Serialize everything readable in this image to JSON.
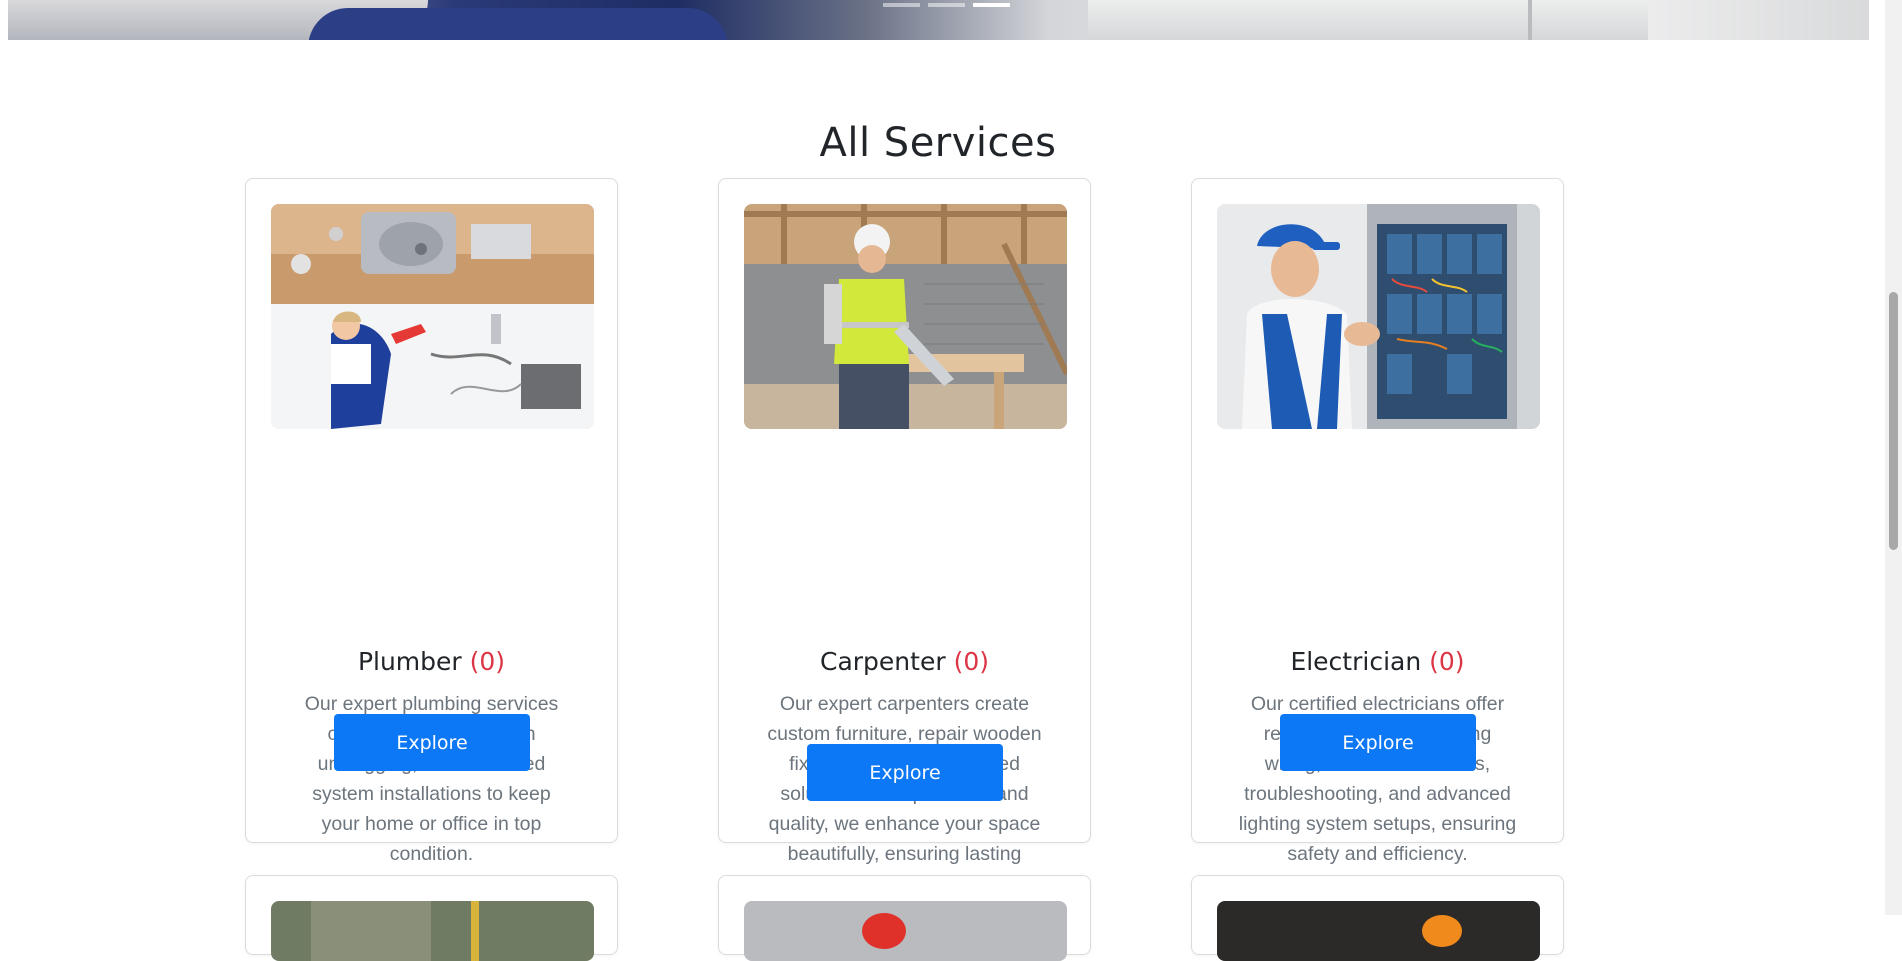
{
  "hero": {
    "slides": 3,
    "active_slide": 3
  },
  "section_title": "All Services",
  "cards": [
    {
      "name": "Plumber",
      "count": "(0)",
      "description": "Our expert plumbing services cover leak repairs, drain unclogging, and advanced system installations to keep your home or office in top condition.",
      "button": "Explore"
    },
    {
      "name": "Carpenter",
      "count": "(0)",
      "description": "Our expert carpenters create custom furniture, repair wooden fixtures, and install tailored solutions. With precision and quality, we enhance your space beautifully, ensuring lasting durability.",
      "button": "Explore"
    },
    {
      "name": "Electrician",
      "count": "(0)",
      "description": "Our certified electricians offer reliable services, including wiring, circuit installations, troubleshooting, and advanced lighting system setups, ensuring safety and efficiency.",
      "button": "Explore"
    }
  ],
  "colors": {
    "accent": "#0d78f5",
    "count": "#dc3545",
    "text": "#212529",
    "muted": "#6c757d"
  }
}
